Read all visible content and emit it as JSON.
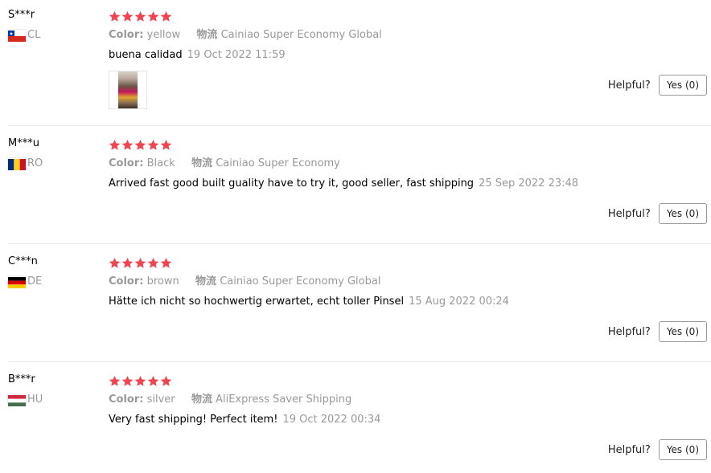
{
  "colors": {
    "star": "#f5424e",
    "meta_gray": "#999999",
    "text": "#000000"
  },
  "reviews": [
    {
      "user": "S***r",
      "country_code": "CL",
      "flag": "chile-flag",
      "rating": 5,
      "color_label": "Color:",
      "color_value": "yellow",
      "logistics_label": "物流",
      "logistics_value": "Cainiao Super Economy Global",
      "text": "buena calidad",
      "date": "19 Oct 2022 11:59",
      "has_photo": true,
      "helpful_label": "Helpful?",
      "yes_label": "Yes (0)"
    },
    {
      "user": "M***u",
      "country_code": "RO",
      "flag": "romania-flag",
      "rating": 5,
      "color_label": "Color:",
      "color_value": "Black",
      "logistics_label": "物流",
      "logistics_value": "Cainiao Super Economy",
      "text": "Arrived fast good built guality have to try it, good seller, fast shipping",
      "date": "25 Sep 2022 23:48",
      "has_photo": false,
      "helpful_label": "Helpful?",
      "yes_label": "Yes (0)"
    },
    {
      "user": "C***n",
      "country_code": "DE",
      "flag": "germany-flag",
      "rating": 5,
      "color_label": "Color:",
      "color_value": "brown",
      "logistics_label": "物流",
      "logistics_value": "Cainiao Super Economy Global",
      "text": "Hätte ich nicht so hochwertig erwartet, echt toller Pinsel",
      "date": "15 Aug 2022 00:24",
      "has_photo": false,
      "helpful_label": "Helpful?",
      "yes_label": "Yes (0)"
    },
    {
      "user": "B***r",
      "country_code": "HU",
      "flag": "hungary-flag",
      "rating": 5,
      "color_label": "Color:",
      "color_value": "silver",
      "logistics_label": "物流",
      "logistics_value": "AliExpress Saver Shipping",
      "text": "Very fast shipping! Perfect item!",
      "date": "19 Oct 2022 00:34",
      "has_photo": false,
      "helpful_label": "Helpful?",
      "yes_label": "Yes (0)"
    }
  ]
}
